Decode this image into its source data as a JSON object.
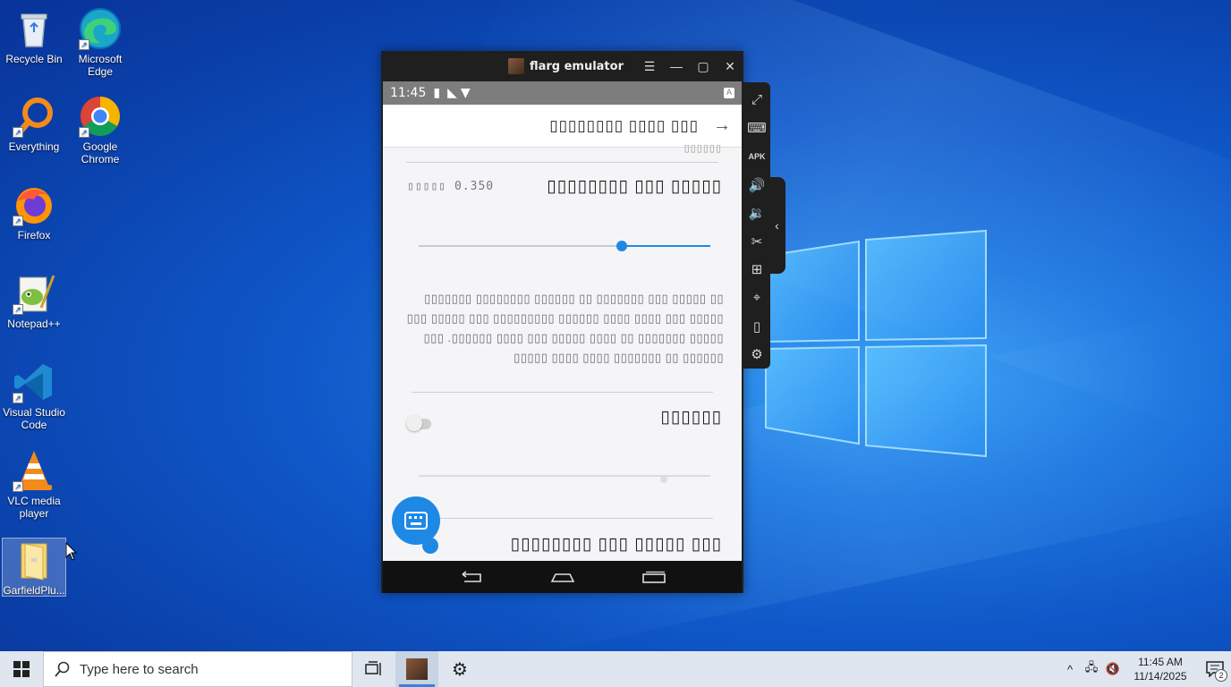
{
  "desktop": {
    "icons": [
      {
        "label": "Recycle Bin",
        "icon": "recycle-bin-icon"
      },
      {
        "label": "Microsoft Edge",
        "icon": "edge-icon"
      },
      {
        "label": "Everything",
        "icon": "everything-search-icon"
      },
      {
        "label": "Google Chrome",
        "icon": "chrome-icon"
      },
      {
        "label": "Firefox",
        "icon": "firefox-icon"
      },
      {
        "label": "Notepad++",
        "icon": "notepadpp-icon"
      },
      {
        "label": "Visual Studio Code",
        "icon": "vscode-icon"
      },
      {
        "label": "VLC media player",
        "icon": "vlc-icon"
      },
      {
        "label": "GarfieldPlu...",
        "icon": "folder-icon"
      }
    ]
  },
  "emulator": {
    "title": "flarg emulator",
    "buttons": {
      "menu": "menu-icon",
      "minimize": "minimize-icon",
      "maximize": "maximize-icon",
      "close": "close-icon"
    },
    "status": {
      "time": "11:45"
    },
    "app": {
      "title": "▯▯▯▯▯▯▯▯ ▯▯▯▯ ▯▯▯",
      "subtitle_fragment": "▯▯▯▯▯▯",
      "setting1": {
        "title": "▯▯▯▯▯▯▯▯ ▯▯▯ ▯▯▯▯▯",
        "value_label": "▯▯▯▯▯ 0.350",
        "slider_value": 0.69
      },
      "description": "▯▯▯▯▯▯▯ ▯▯▯▯▯▯▯▯ ▯▯▯▯▯▯ ▯▯ ▯▯▯▯▯▯▯ ▯▯▯ ▯▯▯▯▯ ▯▯ ▯▯▯ ▯▯▯▯▯ ▯▯▯ ▯▯▯▯▯▯▯▯▯ ▯▯▯▯▯▯ ▯▯▯▯ ▯▯▯▯ ▯▯▯ ▯▯▯▯▯ ▯▯▯ .▯▯▯▯▯▯ ▯▯▯▯ ▯▯▯ ▯▯▯▯▯ ▯▯▯▯ ▯▯ ▯▯▯▯▯▯▯ ▯▯▯▯▯ ▯▯▯▯▯ ▯▯▯▯ ▯▯▯▯ ▯▯▯▯▯▯▯ ▯▯ ▯▯▯▯▯▯",
      "setting2": {
        "title": "▯▯▯▯▯▯",
        "enabled": false
      },
      "setting3": {
        "title": "▯▯▯▯▯▯▯▯ ▯▯▯ ▯▯▯▯▯ ▯▯▯"
      }
    },
    "sidebar": [
      "fullscreen-icon",
      "keyboard-icon",
      "apk-install-icon",
      "volume-up-icon",
      "volume-down-icon",
      "screenshot-cut-icon",
      "multi-instance-icon",
      "location-icon",
      "shake-icon",
      "settings-icon"
    ]
  },
  "taskbar": {
    "search_placeholder": "Type here to search",
    "time": "11:45 AM",
    "date": "11/14/2025",
    "notification_count": "2"
  },
  "colors": {
    "accent": "#1e88e5",
    "desktop_blue": "#0f57c8",
    "window_chrome": "#1f1f1f"
  }
}
